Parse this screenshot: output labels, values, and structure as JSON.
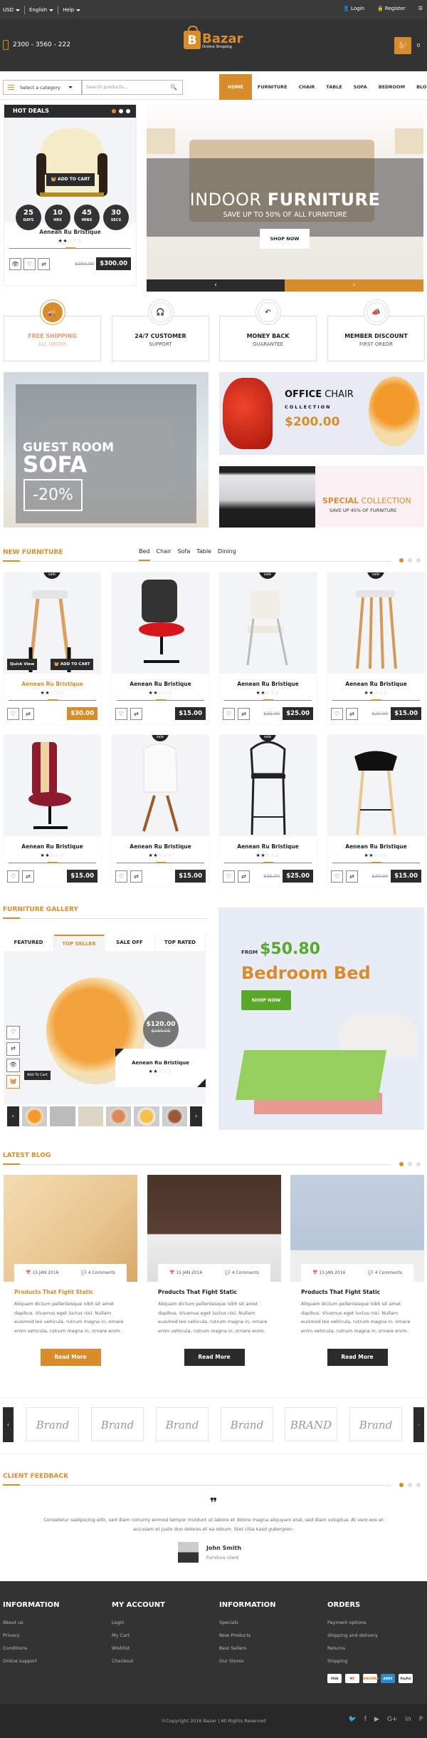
{
  "topbar": {
    "currency": "USD",
    "language": "English",
    "help": "Help",
    "login": "Login",
    "register": "Register"
  },
  "header": {
    "phone": "2300 - 3560 - 222",
    "logo_letter": "B",
    "logo_name": "Bazar",
    "logo_sub": "Online Shoping",
    "cart_count": "0"
  },
  "nav": {
    "category_placeholder": "Select a category",
    "search_placeholder": "Search products...",
    "menu": [
      "HOME",
      "FURNITURE",
      "CHAIR",
      "TABLE",
      "SOFA",
      "BEDROOM",
      "BLOG"
    ]
  },
  "hot_deals": {
    "title": "HOT DEALS",
    "add_to_cart": "ADD TO CART",
    "countdown": [
      {
        "v": "25",
        "l": "DAYS"
      },
      {
        "v": "10",
        "l": "HRS"
      },
      {
        "v": "45",
        "l": "MINS"
      },
      {
        "v": "30",
        "l": "SECS"
      }
    ],
    "product": "Aenean Ru Bristique",
    "rating": 2,
    "old_price": "$350.00",
    "price": "$300.00"
  },
  "slider": {
    "title_light": "INDOOR ",
    "title_bold": "FURNITURE",
    "subtitle": "SAVE UP TO 50% OF ALL FURNITURE",
    "button": "SHOP NOW",
    "prev": "‹",
    "next": "›"
  },
  "services": [
    {
      "t1": "FREE SHIPPING",
      "t2": "ALL ORDER",
      "icon": "🚚"
    },
    {
      "t1": "24/7 CUSTOMER",
      "t2": "SUPPORT",
      "icon": "🎧"
    },
    {
      "t1": "MONEY BACK",
      "t2": "GUARANTEE",
      "icon": "↶"
    },
    {
      "t1": "MEMBER DISCOUNT",
      "t2": "FIRST OREDR",
      "icon": "📣"
    }
  ],
  "banners": {
    "guest": {
      "t1": "GUEST ROOM",
      "t2": "SOFA",
      "discount": "-20%"
    },
    "office": {
      "t1_bold": "OFFICE",
      "t1_light": " CHAIR",
      "t2": "COLLECTION",
      "price": "$200.00"
    },
    "special": {
      "t1_bold": "SPECIAL",
      "t1_light": " COLLECTION",
      "t2": "SAVE UP 45% OF FURNITURE"
    }
  },
  "new_furniture": {
    "title": "NEW FURNITURE",
    "tabs": [
      "Bed",
      "Chair",
      "Sofa",
      "Table",
      "Dining"
    ],
    "quick_view": "Quick View",
    "add_to_cart": "ADD TO CART",
    "sale": "sale",
    "products": [
      {
        "name": "Aenean Ru Bristique",
        "rating": 2,
        "old": "",
        "price": "$30.00",
        "sale": true
      },
      {
        "name": "Aenean Ru Bristique",
        "rating": 2,
        "old": "",
        "price": "$15.00",
        "sale": false
      },
      {
        "name": "Aenean Ru Bristique",
        "rating": 2,
        "old": "$35.00",
        "price": "$25.00",
        "sale": true
      },
      {
        "name": "Aenean Ru Bristique",
        "rating": 2,
        "old": "$20.00",
        "price": "$15.00",
        "sale": true
      },
      {
        "name": "Aenean Ru Bristique",
        "rating": 2,
        "old": "",
        "price": "$15.00",
        "sale": false
      },
      {
        "name": "Aenean Ru Bristique",
        "rating": 2,
        "old": "",
        "price": "$15.00",
        "sale": true
      },
      {
        "name": "Aenean Ru Bristique",
        "rating": 2,
        "old": "$35.00",
        "price": "$25.00",
        "sale": true
      },
      {
        "name": "Aenean Ru Bristique",
        "rating": 2,
        "old": "$20.00",
        "price": "$15.00",
        "sale": false
      }
    ]
  },
  "gallery": {
    "title": "FURNITURE GALLERY",
    "tabs": [
      "FEATURED",
      "TOP SELLER",
      "SALE OFF",
      "TOP RATED"
    ],
    "active_tab": 1,
    "tooltip": "Add To Cart",
    "price": "$120.00",
    "old_price": "$160.00",
    "product": "Aenean Ru Bristique",
    "rating": 2
  },
  "promo": {
    "from": "FROM",
    "price": "$50.80",
    "title": "Bedroom Bed",
    "button": "SHOP NOW"
  },
  "blog": {
    "title": "LATEST BLOG",
    "posts": [
      {
        "date": "15 JAN 2016",
        "comments": "4 Comments",
        "title": "Products That Fight Static",
        "excerpt": "Aliquam dictum pellentesque nibh sit amet dapibus. Vivamus eget luctus nisi. Nullam euismod leo vehicula, rutrum magna in, ornare enim vehicula, rutrum magna in, ornare enim.",
        "button": "Read More"
      },
      {
        "date": "15 JAN 2016",
        "comments": "4 Comments",
        "title": "Products That Fight Static",
        "excerpt": "Aliquam dictum pellentesque nibh sit amet dapibus. Vivamus eget luctus nisi. Nullam euismod leo vehicula, rutrum magna in, ornare enim vehicula, rutrum magna in, ornare enim.",
        "button": "Read More"
      },
      {
        "date": "15 JAN 2016",
        "comments": "4 Comments",
        "title": "Products That Fight Static",
        "excerpt": "Aliquam dictum pellentesque nibh sit amet dapibus. Vivamus eget luctus nisi. Nullam euismod leo vehicula, rutrum magna in, ornare enim vehicula, rutrum magna in, ornare enim.",
        "button": "Read More"
      }
    ]
  },
  "brands": [
    "Brand",
    "Brand",
    "Brand",
    "Brand",
    "BRAND",
    "Brand"
  ],
  "feedback": {
    "title": "CLIENT FEEDBACK",
    "quote": "Consetetur sadipscing elitr, sed diam nonumy eirmod tempor invidunt ut labore et dolore magna aliquyam erat, sed diam voluptua. At vero eos et accusam et justo duo dolores et ea rebum. Stet clita kasd gubergren.",
    "name": "John Smith",
    "role": "Furniture client"
  },
  "footer": {
    "cols": [
      {
        "title": "INFORMATION",
        "links": [
          "About us",
          "Privacy",
          "Conditions",
          "Online support"
        ]
      },
      {
        "title": "MY ACCOUNT",
        "links": [
          "Login",
          "My Cart",
          "Wishlist",
          "Checkout"
        ]
      },
      {
        "title": "INFORMATION",
        "links": [
          "Specials",
          "New Products",
          "Best Sellers",
          "Our Stores"
        ]
      },
      {
        "title": "ORDERS",
        "links": [
          "Payment options",
          "Shipping and delivery",
          "Returns",
          "Shipping"
        ]
      }
    ],
    "payments": [
      "VISA",
      "MC",
      "DISCOVER",
      "AMEX",
      "PayPal"
    ],
    "copyright": "©Copyright 2016 Bazar | All Rights Reserved",
    "social": [
      "twitter",
      "facebook",
      "youtube",
      "google-plus",
      "linkedin",
      "pinterest"
    ]
  },
  "colors": {
    "accent": "#d98c2b",
    "dark": "#333333",
    "green": "#5aa829"
  }
}
